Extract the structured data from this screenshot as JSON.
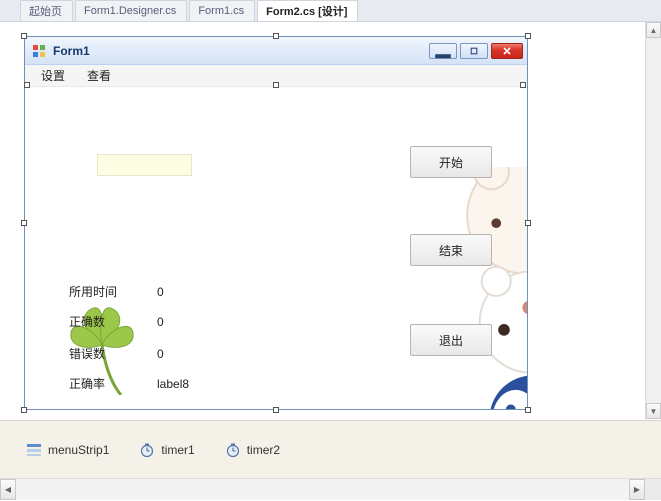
{
  "docTabs": {
    "tab0": "起始页",
    "tab1": "Form1.Designer.cs",
    "tab2": "Form1.cs",
    "tab3": "Form2.cs [设计]"
  },
  "form": {
    "title": "Form1",
    "menu": {
      "item0": "设置",
      "item1": "查看"
    },
    "buttons": {
      "start": "开始",
      "end": "结束",
      "exit": "退出"
    },
    "labels": {
      "time_key": "所用时间",
      "time_val": "0",
      "correct_key": "正确数",
      "correct_val": "0",
      "error_key": "错误数",
      "error_val": "0",
      "rate_key": "正确率",
      "rate_val": "label8"
    },
    "input_value": ""
  },
  "tray": {
    "item0": "menuStrip1",
    "item1": "timer1",
    "item2": "timer2"
  }
}
